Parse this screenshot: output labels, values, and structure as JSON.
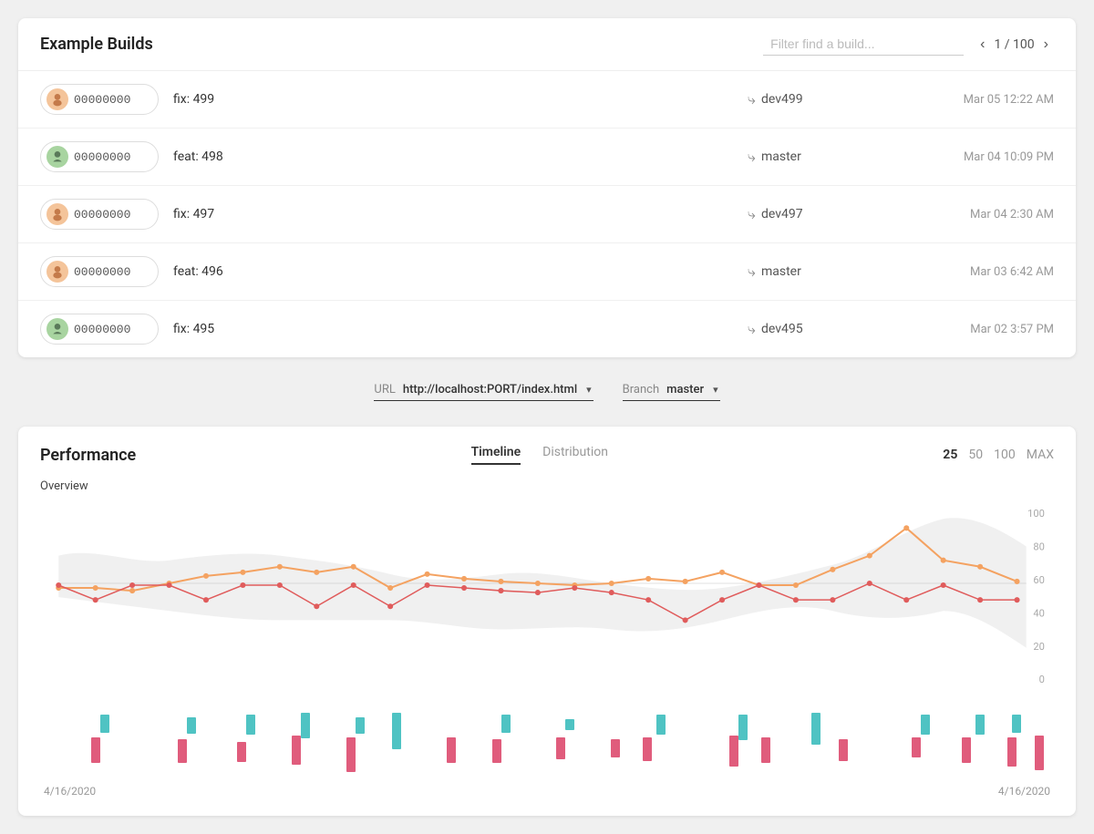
{
  "header": {
    "title": "Example Builds",
    "filter_placeholder": "Filter find a build...",
    "pagination": "1 / 100"
  },
  "builds": [
    {
      "id": "00000000",
      "avatar_class": "avatar-1",
      "name": "fix: 499",
      "branch": "dev499",
      "date": "Mar 05 12:22 AM"
    },
    {
      "id": "00000000",
      "avatar_class": "avatar-2",
      "name": "feat: 498",
      "branch": "master",
      "date": "Mar 04 10:09 PM"
    },
    {
      "id": "00000000",
      "avatar_class": "avatar-3",
      "name": "fix: 497",
      "branch": "dev497",
      "date": "Mar 04 2:30 AM"
    },
    {
      "id": "00000000",
      "avatar_class": "avatar-4",
      "name": "feat: 496",
      "branch": "master",
      "date": "Mar 03 6:42 AM"
    },
    {
      "id": "00000000",
      "avatar_class": "avatar-5",
      "name": "fix: 495",
      "branch": "dev495",
      "date": "Mar 02 3:57 PM"
    }
  ],
  "controls": {
    "url_label": "URL",
    "url_value": "http://localhost:PORT/index.html",
    "branch_label": "Branch",
    "branch_value": "master"
  },
  "performance": {
    "title": "Performance",
    "tabs": [
      "Timeline",
      "Distribution"
    ],
    "active_tab": "Timeline",
    "counts": [
      "25",
      "50",
      "100",
      "MAX"
    ],
    "active_count": "25",
    "overview_label": "Overview",
    "y_labels": [
      "100",
      "80",
      "60",
      "40",
      "20",
      "0"
    ],
    "date_start": "4/16/2020",
    "date_end": "4/16/2020"
  }
}
